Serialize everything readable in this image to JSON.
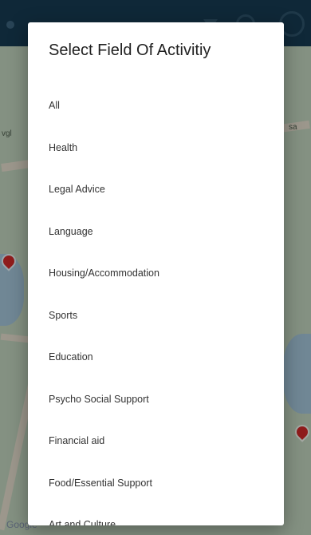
{
  "dialog": {
    "title": "Select Field Of Activitiy",
    "options": [
      {
        "label": "All"
      },
      {
        "label": "Health"
      },
      {
        "label": "Legal Advice"
      },
      {
        "label": "Language"
      },
      {
        "label": "Housing/Accommodation"
      },
      {
        "label": "Sports"
      },
      {
        "label": "Education"
      },
      {
        "label": "Psycho Social Support"
      },
      {
        "label": "Financial aid"
      },
      {
        "label": "Food/Essential Support"
      },
      {
        "label": "Art and Culture"
      }
    ]
  },
  "background": {
    "map_watermark": "Google",
    "app_bar_color": "#16384e",
    "pin_color": "#c62828"
  }
}
